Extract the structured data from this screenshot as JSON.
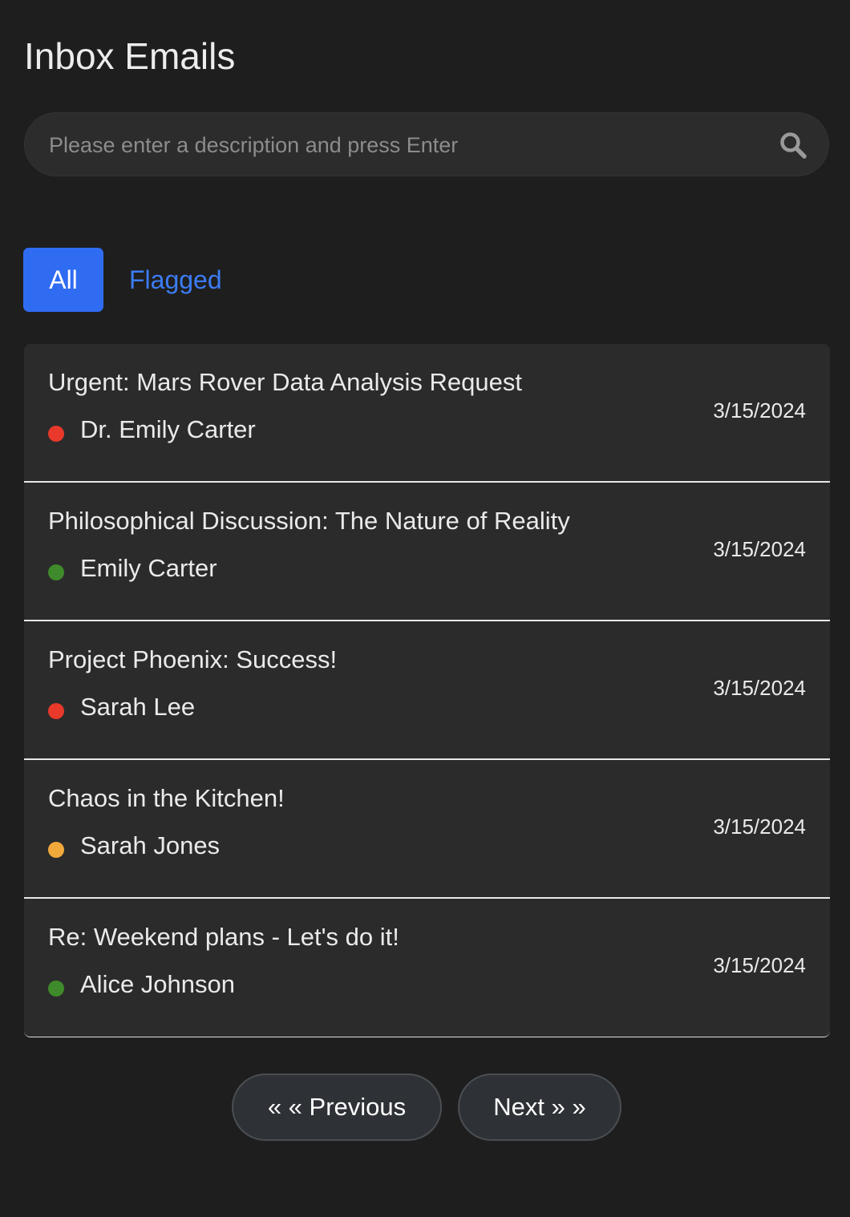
{
  "header": {
    "title": "Inbox Emails"
  },
  "search": {
    "placeholder": "Please enter a description and press Enter",
    "value": "",
    "icon": "search-icon"
  },
  "tabs": [
    {
      "label": "All",
      "active": true
    },
    {
      "label": "Flagged",
      "active": false
    }
  ],
  "colors": {
    "accent": "#2f6cf2",
    "link": "#3c7cf4",
    "status_red": "#e8392a",
    "status_green": "#3f8a2a",
    "status_orange": "#f2a93b",
    "background": "#1e1e1e",
    "card": "#2b2b2b"
  },
  "emails": [
    {
      "subject": "Urgent: Mars Rover Data Analysis Request",
      "sender": "Dr. Emily Carter",
      "date": "3/15/2024",
      "status_color": "#e8392a"
    },
    {
      "subject": "Philosophical Discussion: The Nature of Reality",
      "sender": "Emily Carter",
      "date": "3/15/2024",
      "status_color": "#3f8a2a"
    },
    {
      "subject": "Project Phoenix: Success!",
      "sender": "Sarah Lee",
      "date": "3/15/2024",
      "status_color": "#e8392a"
    },
    {
      "subject": "Chaos in the Kitchen!",
      "sender": "Sarah Jones",
      "date": "3/15/2024",
      "status_color": "#f2a93b"
    },
    {
      "subject": "Re: Weekend plans - Let's do it!",
      "sender": "Alice Johnson",
      "date": "3/15/2024",
      "status_color": "#3f8a2a"
    }
  ],
  "pagination": {
    "previous_label": "« « Previous",
    "next_label": "Next » »"
  }
}
